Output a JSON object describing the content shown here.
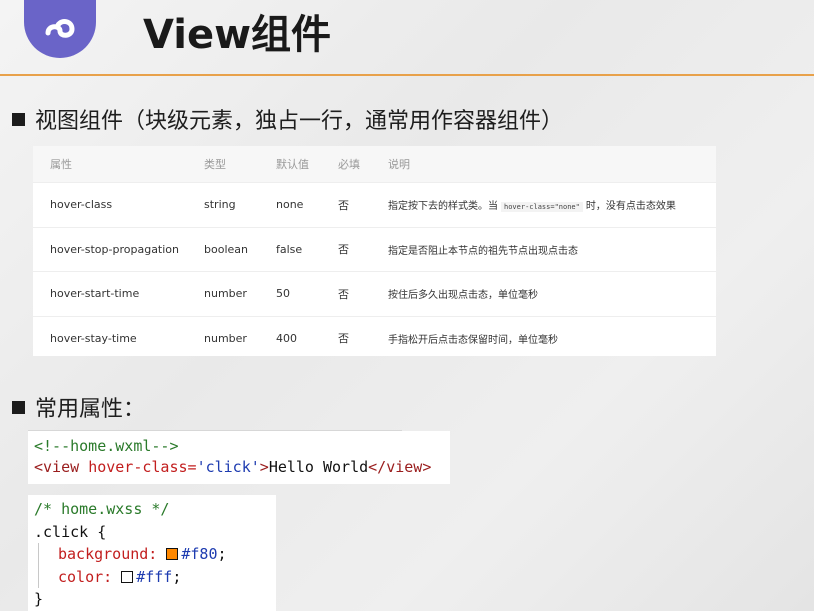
{
  "slide": {
    "title": "View组件",
    "section1": "视图组件（块级元素，独占一行，通常用作容器组件）",
    "section2": "常用属性："
  },
  "table": {
    "headers": [
      "属性",
      "类型",
      "默认值",
      "必填",
      "说明"
    ],
    "rows": [
      {
        "name": "hover-class",
        "type": "string",
        "default": "none",
        "required": "否",
        "desc_pre": "指定按下去的样式类。当",
        "desc_code": "hover-class=\"none\"",
        "desc_post": "时，没有点击态效果"
      },
      {
        "name": "hover-stop-propagation",
        "type": "boolean",
        "default": "false",
        "required": "否",
        "desc": "指定是否阻止本节点的祖先节点出现点击态"
      },
      {
        "name": "hover-start-time",
        "type": "number",
        "default": "50",
        "required": "否",
        "desc": "按住后多久出现点击态，单位毫秒"
      },
      {
        "name": "hover-stay-time",
        "type": "number",
        "default": "400",
        "required": "否",
        "desc": "手指松开后点击态保留时间，单位毫秒"
      }
    ]
  },
  "code_wxml": {
    "comment": "<!--home.wxml-->",
    "open_tag": "<view",
    "attr": "hover-class=",
    "value": "'click'",
    "close_bracket": ">",
    "text": "Hello World",
    "end_tag": "</view>"
  },
  "code_wxss": {
    "comment": "/* home.wxss */",
    "selector": ".click {",
    "prop1": "background:",
    "val1": "#f80",
    "prop2": "color:",
    "val2": "#fff",
    "semicolon": ";",
    "close": "}"
  },
  "colors": {
    "accent_rule": "#e8a14a",
    "logo": "#6a64c8",
    "swatch1": "#ff8800",
    "swatch2": "#ffffff"
  },
  "icons": {
    "logo": "mini-program-logo-icon"
  }
}
